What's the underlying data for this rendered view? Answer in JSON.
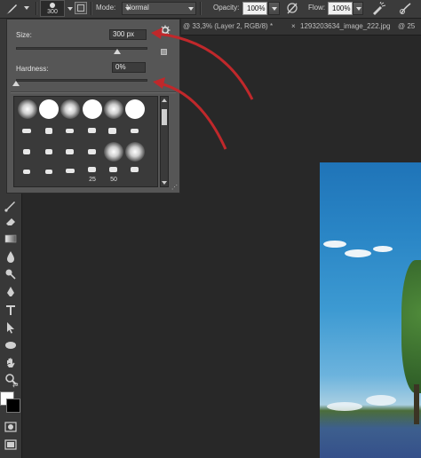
{
  "options_bar": {
    "brush_size_preview": "300",
    "mode_label": "Mode:",
    "mode_value": "Normal",
    "opacity_label": "Opacity:",
    "opacity_value": "100%",
    "flow_label": "Flow:",
    "flow_value": "100%"
  },
  "document_tabs": [
    {
      "title": "@ 33,3% (Layer 2, RGB/8) *",
      "close": "×"
    },
    {
      "title": "1293203634_image_222.jpg",
      "close": "@ 25"
    }
  ],
  "brush_panel": {
    "size_label": "Size:",
    "size_value": "300 px",
    "hardness_label": "Hardness:",
    "hardness_value": "0%",
    "size_fraction": 0.77,
    "hardness_fraction": 0.0,
    "preset_numbers": [
      "25",
      "50"
    ]
  },
  "toolbar_icons": [
    "brush-icon",
    "eraser-icon",
    "gradient-icon",
    "blur-icon",
    "dodge-icon",
    "pen-icon",
    "type-icon",
    "path-selection-icon",
    "ellipse-icon",
    "hand-icon",
    "zoom-icon",
    "quick-mask-icon"
  ],
  "colors": {
    "foreground": "#ffffff",
    "background": "#000000",
    "annotation_arrow": "#c0282b"
  }
}
